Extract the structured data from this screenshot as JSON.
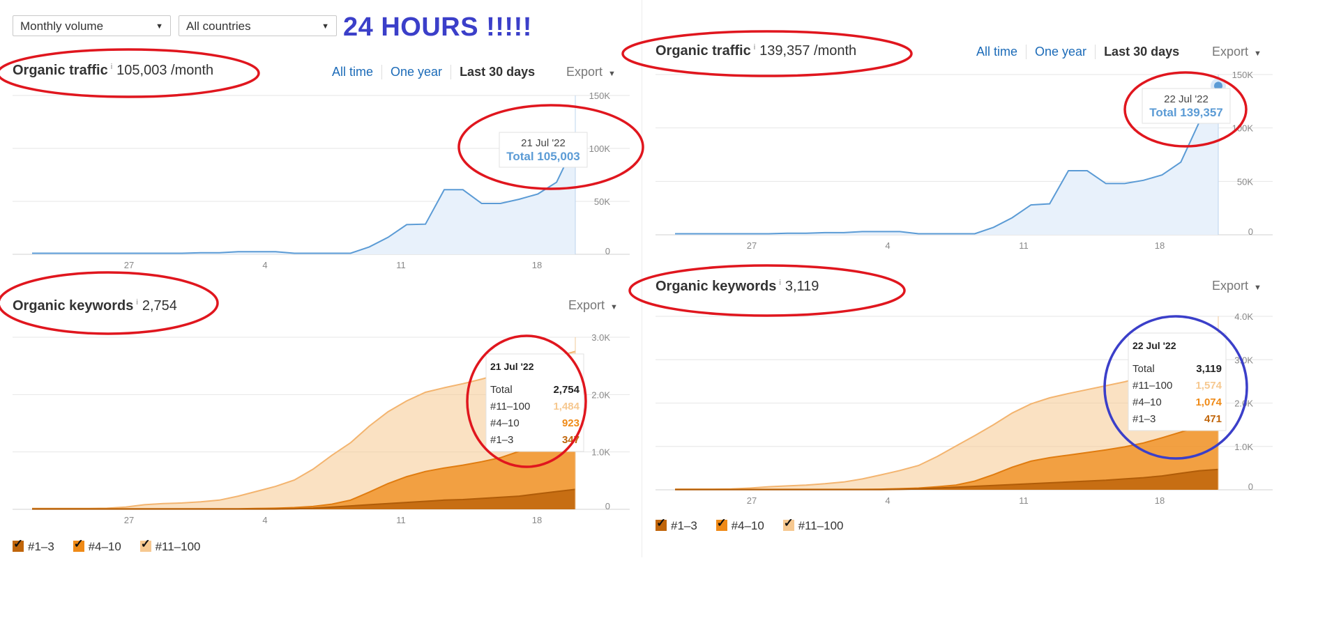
{
  "controls": {
    "metric_select": "Monthly volume",
    "country_select": "All countries",
    "headline": "24 HOURS !!!!!"
  },
  "left": {
    "traffic": {
      "title": "Organic traffic",
      "info": "i",
      "value": "105,003 /month",
      "ranges": [
        "All time",
        "One year",
        "Last 30 days"
      ],
      "export": "Export",
      "tooltip_date": "21 Jul '22",
      "tooltip_total": "Total 105,003"
    },
    "keywords": {
      "title": "Organic keywords",
      "info": "i",
      "value": "2,754",
      "export": "Export",
      "tooltip": {
        "date": "21 Jul '22",
        "rows": [
          {
            "label": "Total",
            "value": "2,754"
          },
          {
            "label": "#11–100",
            "value": "1,484"
          },
          {
            "label": "#4–10",
            "value": "923"
          },
          {
            "label": "#1–3",
            "value": "347"
          }
        ]
      },
      "legend": [
        "#1–3",
        "#4–10",
        "#11–100"
      ]
    }
  },
  "right": {
    "traffic": {
      "title": "Organic traffic",
      "info": "i",
      "value": "139,357 /month",
      "ranges": [
        "All time",
        "One year",
        "Last 30 days"
      ],
      "export": "Export",
      "tooltip_date": "22 Jul '22",
      "tooltip_total": "Total 139,357"
    },
    "keywords": {
      "title": "Organic keywords",
      "info": "i",
      "value": "3,119",
      "export": "Export",
      "tooltip": {
        "date": "22 Jul '22",
        "rows": [
          {
            "label": "Total",
            "value": "3,119"
          },
          {
            "label": "#11–100",
            "value": "1,574"
          },
          {
            "label": "#4–10",
            "value": "1,074"
          },
          {
            "label": "#1–3",
            "value": "471"
          }
        ]
      },
      "legend": [
        "#1–3",
        "#4–10",
        "#11–100"
      ]
    }
  },
  "colors": {
    "traffic_line": "#5b9bd5",
    "traffic_fill": "#e8f1fb",
    "kw_top3": "#c0650a",
    "kw_top10": "#ef8a17",
    "kw_top100": "#f6c890",
    "grid": "#e6e6e6",
    "annotation_red": "#e0161e",
    "annotation_blue": "#3b3fc9"
  },
  "chart_data": [
    {
      "type": "area",
      "panel": "left-traffic",
      "title": "Organic traffic",
      "x_ticks": [
        "27",
        "4",
        "11",
        "18"
      ],
      "y_ticks": [
        "0",
        "50K",
        "100K",
        "150K"
      ],
      "ylim": [
        0,
        150000
      ],
      "x": [
        22,
        23,
        24,
        25,
        26,
        27,
        28,
        29,
        30,
        1,
        2,
        3,
        4,
        5,
        6,
        7,
        8,
        9,
        10,
        11,
        12,
        13,
        14,
        15,
        16,
        17,
        18,
        19,
        20,
        21
      ],
      "series": [
        {
          "values": [
            1000,
            1000,
            1000,
            1000,
            1000,
            1000,
            1000,
            1000,
            1000,
            1500,
            1500,
            2500,
            2500,
            2500,
            1000,
            1000,
            1000,
            1000,
            7000,
            16000,
            28000,
            28500,
            61000,
            61000,
            48000,
            48000,
            52000,
            57000,
            68000,
            105003
          ]
        }
      ]
    },
    {
      "type": "area",
      "panel": "left-keywords",
      "title": "Organic keywords",
      "x_ticks": [
        "27",
        "4",
        "11",
        "18"
      ],
      "y_ticks": [
        "0",
        "1.0K",
        "2.0K",
        "3.0K"
      ],
      "ylim": [
        0,
        3000
      ],
      "x": [
        22,
        23,
        24,
        25,
        26,
        27,
        28,
        29,
        30,
        1,
        2,
        3,
        4,
        5,
        6,
        7,
        8,
        9,
        10,
        11,
        12,
        13,
        14,
        15,
        16,
        17,
        18,
        19,
        20,
        21
      ],
      "series": [
        {
          "name": "#1–3",
          "values": [
            5,
            5,
            5,
            5,
            5,
            5,
            5,
            5,
            5,
            5,
            5,
            5,
            5,
            5,
            10,
            20,
            40,
            60,
            80,
            100,
            120,
            140,
            160,
            170,
            190,
            210,
            230,
            270,
            310,
            347
          ]
        },
        {
          "name": "#4–10",
          "values": [
            5,
            5,
            5,
            5,
            5,
            5,
            5,
            5,
            5,
            5,
            5,
            5,
            10,
            15,
            20,
            30,
            50,
            100,
            220,
            350,
            450,
            520,
            560,
            600,
            640,
            690,
            780,
            830,
            870,
            923
          ]
        },
        {
          "name": "#11–100",
          "values": [
            5,
            5,
            5,
            5,
            10,
            30,
            70,
            90,
            100,
            120,
            150,
            220,
            300,
            380,
            480,
            650,
            850,
            1000,
            1150,
            1250,
            1320,
            1380,
            1400,
            1420,
            1440,
            1460,
            1470,
            1478,
            1482,
            1484
          ]
        }
      ]
    },
    {
      "type": "area",
      "panel": "right-traffic",
      "title": "Organic traffic",
      "x_ticks": [
        "27",
        "4",
        "11",
        "18"
      ],
      "y_ticks": [
        "0",
        "50K",
        "100K",
        "150K"
      ],
      "ylim": [
        0,
        150000
      ],
      "x": [
        23,
        24,
        25,
        26,
        27,
        28,
        29,
        30,
        1,
        2,
        3,
        4,
        5,
        6,
        7,
        8,
        9,
        10,
        11,
        12,
        13,
        14,
        15,
        16,
        17,
        18,
        19,
        20,
        21,
        22
      ],
      "series": [
        {
          "values": [
            1000,
            1000,
            1000,
            1000,
            1000,
            1000,
            1500,
            1500,
            2000,
            2000,
            3000,
            3000,
            3000,
            1000,
            1000,
            1000,
            1000,
            7000,
            16000,
            28000,
            29000,
            60000,
            60000,
            48000,
            48000,
            51000,
            56000,
            68000,
            106000,
            139357
          ]
        }
      ]
    },
    {
      "type": "area",
      "panel": "right-keywords",
      "title": "Organic keywords",
      "x_ticks": [
        "27",
        "4",
        "11",
        "18"
      ],
      "y_ticks": [
        "0",
        "1.0K",
        "2.0K",
        "3.0K",
        "4.0K"
      ],
      "ylim": [
        0,
        4000
      ],
      "x": [
        23,
        24,
        25,
        26,
        27,
        28,
        29,
        30,
        1,
        2,
        3,
        4,
        5,
        6,
        7,
        8,
        9,
        10,
        11,
        12,
        13,
        14,
        15,
        16,
        17,
        18,
        19,
        20,
        21,
        22
      ],
      "series": [
        {
          "name": "#1–3",
          "values": [
            5,
            5,
            5,
            5,
            5,
            5,
            5,
            5,
            5,
            5,
            5,
            5,
            10,
            20,
            40,
            60,
            80,
            100,
            120,
            140,
            160,
            180,
            200,
            220,
            250,
            280,
            320,
            380,
            440,
            471
          ]
        },
        {
          "name": "#4–10",
          "values": [
            5,
            5,
            5,
            5,
            5,
            5,
            5,
            5,
            5,
            5,
            5,
            10,
            15,
            20,
            30,
            50,
            120,
            250,
            400,
            520,
            580,
            620,
            660,
            700,
            740,
            800,
            880,
            950,
            1020,
            1074
          ]
        },
        {
          "name": "#11–100",
          "values": [
            5,
            5,
            5,
            10,
            30,
            60,
            80,
            100,
            130,
            170,
            240,
            330,
            420,
            520,
            700,
            900,
            1050,
            1150,
            1250,
            1320,
            1380,
            1420,
            1450,
            1480,
            1500,
            1520,
            1540,
            1555,
            1568,
            1574
          ]
        }
      ]
    }
  ]
}
